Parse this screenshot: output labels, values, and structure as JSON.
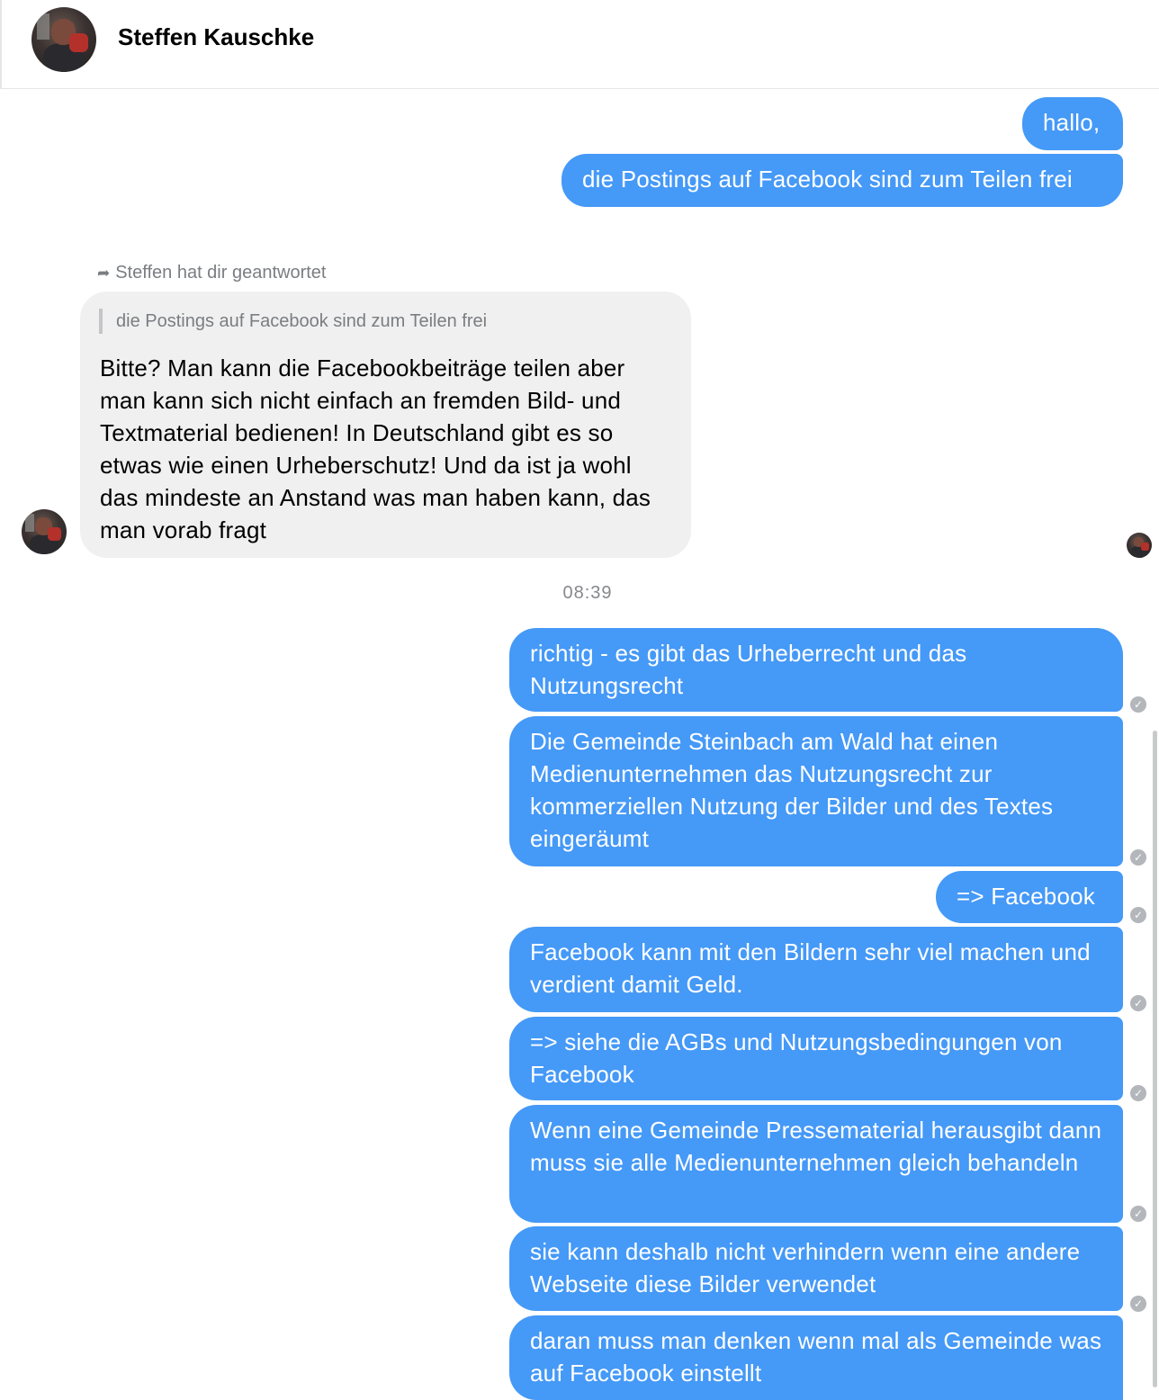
{
  "header": {
    "contact_name": "Steffen Kauschke"
  },
  "messages_top": [
    {
      "text": "hallo,"
    },
    {
      "text": "die Postings auf Facebook sind zum Teilen frei"
    }
  ],
  "reply": {
    "meta": "Steffen hat dir geantwortet",
    "quoted": "die Postings auf Facebook sind zum Teilen frei",
    "text": "Bitte? Man kann die Facebookbeiträge teilen aber man kann sich nicht einfach an fremden Bild- und Textmaterial bedienen! In Deutschland gibt es so etwas wie einen Urheberschutz! Und da ist ja wohl das mindeste an Anstand was man haben kann, das man vorab fragt"
  },
  "timestamp": "08:39",
  "messages_bottom": [
    {
      "text": "richtig - es gibt das Urheberrecht und das Nutzungsrecht"
    },
    {
      "text": "Die Gemeinde Steinbach am Wald hat einen Medienunternehmen das Nutzungsrecht zur kommerziellen Nutzung der Bilder und des Textes eingeräumt"
    },
    {
      "text": "=> Facebook"
    },
    {
      "text": "Facebook kann mit den Bildern sehr viel machen und verdient damit Geld."
    },
    {
      "text": "=> siehe die AGBs und Nutzungsbedingungen von Facebook"
    },
    {
      "text": "Wenn  eine Gemeinde Pressematerial herausgibt dann muss sie alle Medienunternehmen gleich behandeln"
    },
    {
      "text": "sie kann deshalb nicht verhindern wenn eine andere Webseite diese Bilder verwendet"
    },
    {
      "text": "daran muss man denken wenn mal als Gemeinde was auf Facebook einstellt"
    }
  ],
  "colors": {
    "outgoing_bubble": "#4599f7",
    "incoming_bubble": "#f0f0f0",
    "meta_text": "#7a7d81"
  },
  "icons": {
    "share": "share-arrow-icon",
    "delivered": "check-circle-icon"
  }
}
